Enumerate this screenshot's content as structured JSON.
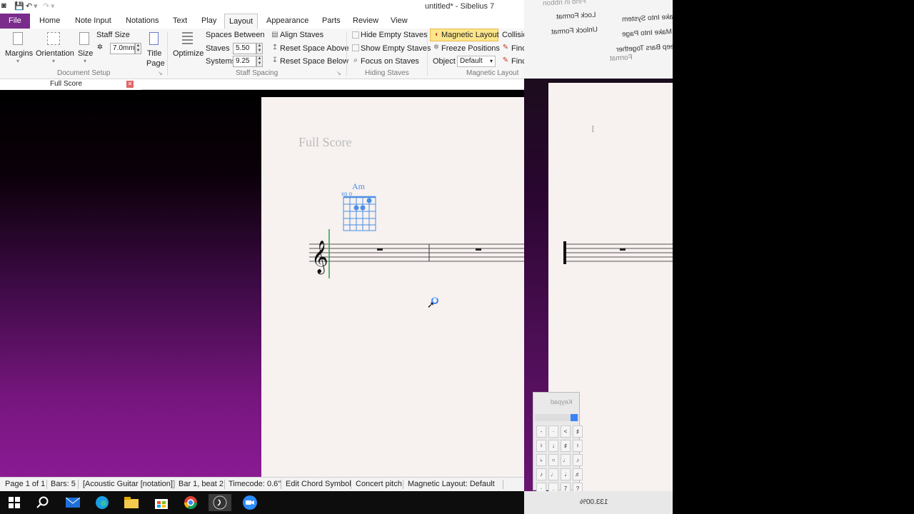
{
  "titlebar": {
    "window_title": "untitled* - Sibelius 7"
  },
  "ribbon_tabs": [
    "File",
    "Home",
    "Note Input",
    "Notations",
    "Text",
    "Play",
    "Layout",
    "Appearance",
    "Parts",
    "Review",
    "View"
  ],
  "ribbon": {
    "document_setup": {
      "margins": "Margins",
      "orientation": "Orientation",
      "size": "Size",
      "staff_size_label": "Staff Size",
      "staff_size_value": "7.0mm",
      "title_page_1": "Title",
      "title_page_2": "Page",
      "group": "Document Setup"
    },
    "staff_spacing": {
      "optimize": "Optimize",
      "spaces_between": "Spaces Between",
      "staves_label": "Staves",
      "staves_value": "5.50",
      "systems_label": "Systems",
      "systems_value": "9.25",
      "align_staves": "Align Staves",
      "reset_above": "Reset Space Above",
      "reset_below": "Reset Space Below",
      "group": "Staff Spacing"
    },
    "hiding_staves": {
      "hide_empty": "Hide Empty Staves",
      "show_empty": "Show Empty Staves",
      "focus": "Focus on Staves",
      "group": "Hiding Staves"
    },
    "magnetic_layout": {
      "magnetic": "Magnetic Layout",
      "freeze": "Freeze Positions",
      "object_label": "Object",
      "object_value": "Default",
      "collision": "Collisio",
      "find1": "Finc",
      "find2": "Finc",
      "group": "Magnetic Layout"
    }
  },
  "doc_tab": {
    "label": "Full Score"
  },
  "score": {
    "title": "Full Score",
    "chord_symbol": "Am",
    "chord_markers": "xo        o",
    "bar_number_right": "I"
  },
  "statusbar": {
    "page": "Page 1 of 1",
    "bars": "Bars: 5",
    "instrument": "[Acoustic Guitar [notation]]",
    "position": "Bar 1, beat 2",
    "timecode": "Timecode: 0.6\"",
    "mode": "Edit Chord Symbol",
    "pitch": "Concert pitch",
    "magnetic": "Magnetic Layout: Default"
  },
  "right_panel": {
    "mirror_find": "Find in ribbon",
    "mirror_lock": "Lock Format",
    "mirror_unlock": "Unlock Format",
    "mirror_make_system": "Make Into System",
    "mirror_make_page": "Make Into Page",
    "mirror_keep_bars": "Keep Bars Together",
    "mirror_format": "Format",
    "keypad_title": "Keypad",
    "zoom": "133.00%"
  },
  "keypad_keys": [
    "-",
    "·",
    "<",
    "♯",
    "♮",
    "↓",
    "♯",
    "♮",
    "♭",
    "○",
    "♩",
    "♪",
    "♪",
    "♩",
    "𝅗𝅥",
    "♬",
    "·",
    ".",
    "7",
    "?"
  ],
  "taskbar_icons": [
    "windows-start-icon",
    "search-icon",
    "mail-icon",
    "edge-icon",
    "file-explorer-icon",
    "store-icon",
    "chrome-icon",
    "sibelius-icon",
    "zoom-icon"
  ]
}
